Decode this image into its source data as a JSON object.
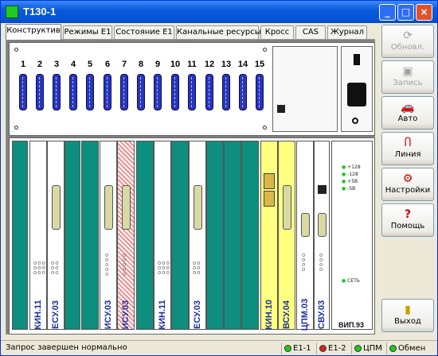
{
  "window": {
    "title": "T130-1",
    "minimize": "_",
    "maximize": "□",
    "close": "×"
  },
  "tabs": [
    "Конструктив",
    "Режимы E1",
    "Состояние E1",
    "Канальные ресурсы",
    "Кросс",
    "CAS",
    "Журнал"
  ],
  "active_tab": "Конструктив",
  "slots": [
    "1",
    "2",
    "3",
    "4",
    "5",
    "6",
    "7",
    "8",
    "9",
    "10",
    "11",
    "12",
    "13",
    "14",
    "15"
  ],
  "cards": [
    "КИН.11",
    "ЕСУ.03",
    "ИСУ.03",
    "ИСУ.03",
    "КИН.11",
    "ЕСУ.03",
    "КИН.10",
    "ВСУ.04",
    "ЦПМ.03",
    "СВУ.03",
    "ВИП.93"
  ],
  "vip": {
    "leds": [
      "+128",
      "-128",
      "+5В",
      "-5В"
    ],
    "net": "СЕТЬ"
  },
  "sidebar": {
    "buttons": [
      {
        "label": "Обновл.",
        "icon": "refresh-icon",
        "enabled": false
      },
      {
        "label": "Запись",
        "icon": "save-icon",
        "enabled": false
      },
      {
        "label": "Авто",
        "icon": "car-icon",
        "enabled": true
      },
      {
        "label": "Линия",
        "icon": "magnet-icon",
        "enabled": true
      },
      {
        "label": "Настройки",
        "icon": "settings-icon",
        "enabled": true
      },
      {
        "label": "Помощь",
        "icon": "help-icon",
        "enabled": true
      }
    ],
    "exit": "Выход"
  },
  "status": {
    "text": "Запрос завершен нормально",
    "indicators": [
      {
        "label": "E1-1",
        "color": "#1ec81e"
      },
      {
        "label": "E1-2",
        "color": "#e02020"
      },
      {
        "label": "ЦПМ",
        "color": "#1ec81e"
      },
      {
        "label": "Обмен",
        "color": "#1ec81e"
      }
    ]
  },
  "colors": {
    "titlebar": "#0553d6",
    "card_teal": "#0e8e7e",
    "card_yellow": "#ffff80",
    "card_red": "#f09090"
  }
}
